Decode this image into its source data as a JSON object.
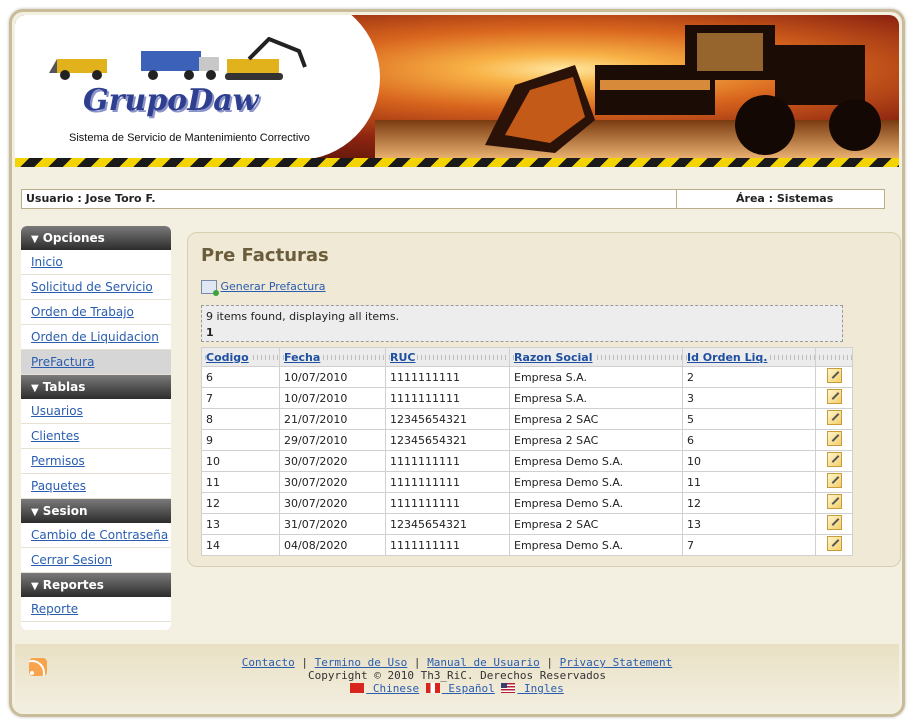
{
  "header": {
    "logo_text": "GrupoDaw",
    "subtitle": "Sistema de Servicio de Mantenimiento Correctivo"
  },
  "userbar": {
    "user": "Usuario : Jose Toro F.",
    "area": "Área : Sistemas"
  },
  "sidebar": {
    "sections": [
      {
        "title": "Opciones",
        "items": [
          "Inicio",
          "Solicitud de Servicio",
          "Orden de Trabajo",
          "Orden de Liquidacion",
          "PreFactura"
        ]
      },
      {
        "title": "Tablas",
        "items": [
          "Usuarios",
          "Clientes",
          "Permisos",
          "Paquetes"
        ]
      },
      {
        "title": "Sesion",
        "items": [
          "Cambio de Contraseña",
          "Cerrar Sesion"
        ]
      },
      {
        "title": "Reportes",
        "items": [
          "Reporte"
        ]
      }
    ],
    "active_item": "PreFactura"
  },
  "main": {
    "title": "Pre Facturas",
    "generate_link": "Generar Prefactura",
    "info_text": "9 items found, displaying all items.",
    "page": "1",
    "columns": [
      "Codigo",
      "Fecha",
      "RUC",
      "Razon Social",
      "Id Orden Liq."
    ],
    "rows": [
      [
        "6",
        "10/07/2010",
        "1111111111",
        "Empresa S.A.",
        "2"
      ],
      [
        "7",
        "10/07/2010",
        "1111111111",
        "Empresa S.A.",
        "3"
      ],
      [
        "8",
        "21/07/2010",
        "12345654321",
        "Empresa 2 SAC",
        "5"
      ],
      [
        "9",
        "29/07/2010",
        "12345654321",
        "Empresa 2 SAC",
        "6"
      ],
      [
        "10",
        "30/07/2020",
        "1111111111",
        "Empresa Demo S.A.",
        "10"
      ],
      [
        "11",
        "30/07/2020",
        "1111111111",
        "Empresa Demo S.A.",
        "11"
      ],
      [
        "12",
        "30/07/2020",
        "1111111111",
        "Empresa Demo S.A.",
        "12"
      ],
      [
        "13",
        "31/07/2020",
        "12345654321",
        "Empresa 2 SAC",
        "13"
      ],
      [
        "14",
        "04/08/2020",
        "1111111111",
        "Empresa Demo S.A.",
        "7"
      ]
    ]
  },
  "footer": {
    "links": [
      "Contacto",
      "Termino de Uso",
      "Manual de Usuario",
      "Privacy Statement"
    ],
    "copyright": "Copyright © 2010 Th3_RiC. Derechos Reservados",
    "languages": [
      " Chinese",
      " Español",
      " Ingles"
    ]
  }
}
